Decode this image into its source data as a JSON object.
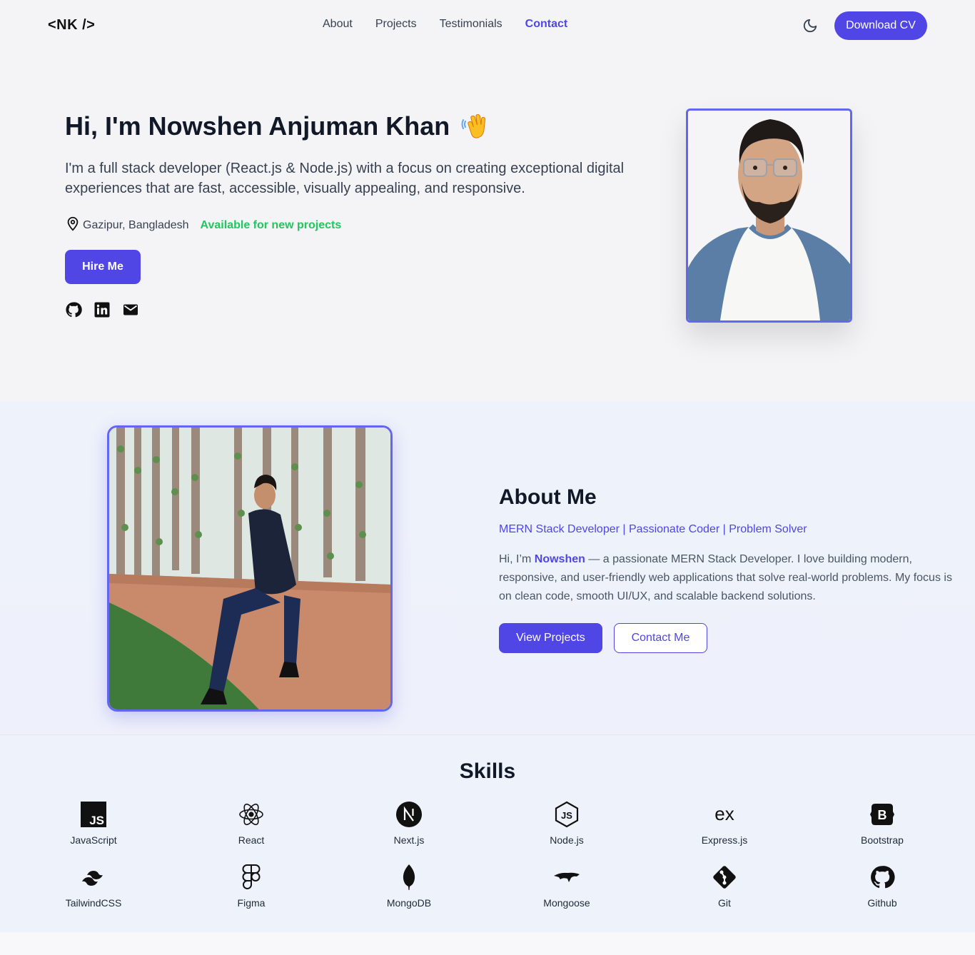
{
  "nav": {
    "logo": "<NK />",
    "links": [
      "About",
      "Projects",
      "Testimonials",
      "Contact"
    ],
    "active_link": "Contact",
    "cv_button": "Download CV"
  },
  "hero": {
    "title": "Hi, I'm Nowshen Anjuman Khan",
    "description": "I'm a full stack developer (React.js & Node.js) with a focus on creating exceptional digital experiences that are fast, accessible, visually appealing, and responsive.",
    "location": "Gazipur, Bangladesh",
    "availability": "Available for new projects",
    "hire_button": "Hire Me",
    "socials": [
      "github-icon",
      "linkedin-icon",
      "mail-icon"
    ]
  },
  "about": {
    "title": "About Me",
    "subtitle": "MERN Stack Developer | Passionate Coder | Problem Solver",
    "text_prefix": "Hi, I’m ",
    "name": "Nowshen",
    "text_suffix": " — a passionate MERN Stack Developer. I love building modern, responsive, and user-friendly web applications that solve real-world problems. My focus is on clean code, smooth UI/UX, and scalable backend solutions.",
    "view_projects": "View Projects",
    "contact_me": "Contact Me"
  },
  "skills": {
    "title": "Skills",
    "items": [
      {
        "label": "JavaScript",
        "icon": "javascript-icon"
      },
      {
        "label": "React",
        "icon": "react-icon"
      },
      {
        "label": "Next.js",
        "icon": "nextjs-icon"
      },
      {
        "label": "Node.js",
        "icon": "nodejs-icon"
      },
      {
        "label": "Express.js",
        "icon": "express-icon"
      },
      {
        "label": "Bootstrap",
        "icon": "bootstrap-icon"
      },
      {
        "label": "TailwindCSS",
        "icon": "tailwind-icon"
      },
      {
        "label": "Figma",
        "icon": "figma-icon"
      },
      {
        "label": "MongoDB",
        "icon": "mongodb-icon"
      },
      {
        "label": "Mongoose",
        "icon": "mongoose-icon"
      },
      {
        "label": "Git",
        "icon": "git-icon"
      },
      {
        "label": "Github",
        "icon": "github-icon"
      }
    ]
  },
  "colors": {
    "accent": "#4f46e5",
    "available": "#22c55e"
  }
}
